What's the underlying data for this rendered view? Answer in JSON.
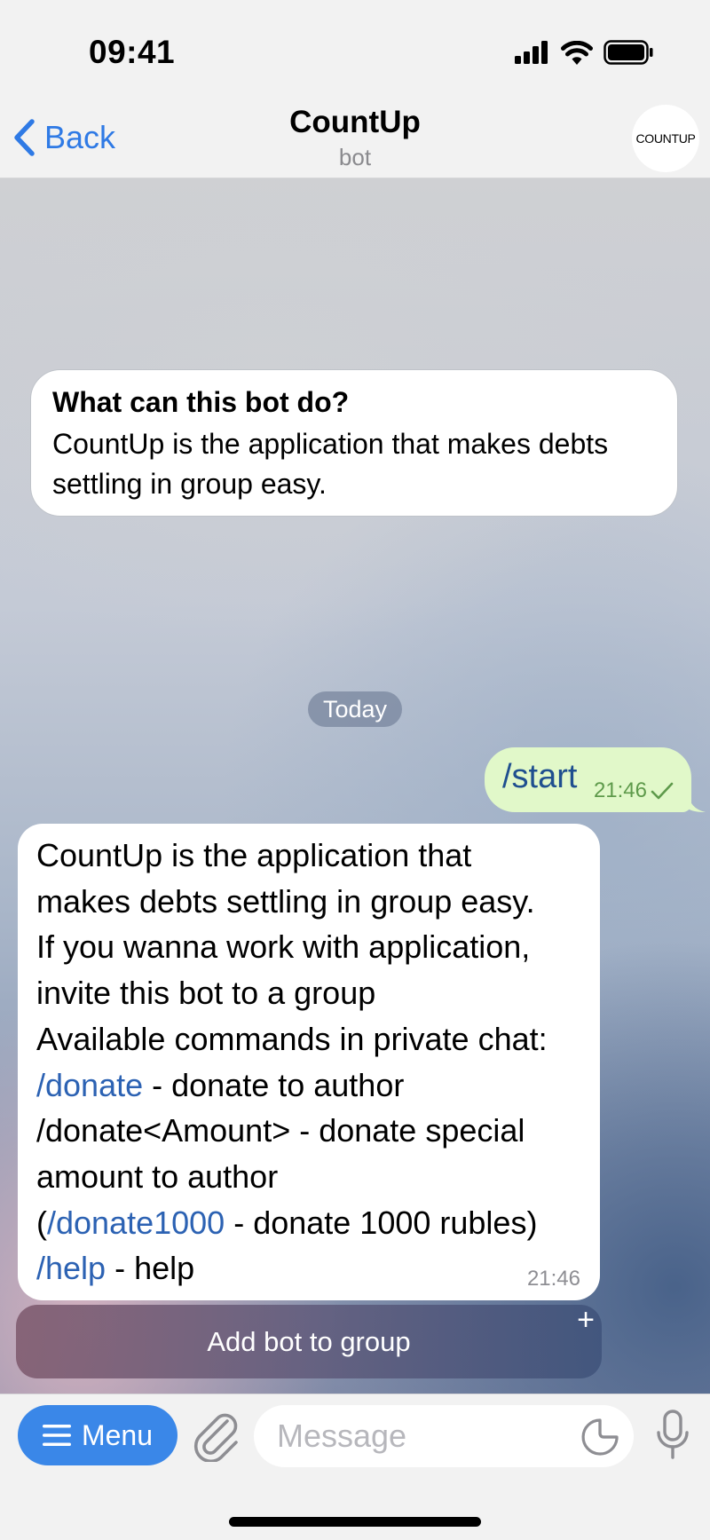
{
  "status_bar": {
    "time": "09:41"
  },
  "nav": {
    "back_label": "Back",
    "title": "CountUp",
    "subtitle": "bot",
    "avatar_text": "COUNTUP"
  },
  "bot_info": {
    "title": "What can this bot do?",
    "description": "CountUp is the application that makes debts settling in group easy."
  },
  "date_separator": "Today",
  "outgoing_message": {
    "text": "/start",
    "time": "21:46"
  },
  "incoming_message": {
    "line1": "CountUp is the application that",
    "line2": "makes debts settling in group easy.",
    "line3": "If you wanna work with application,",
    "line4": "invite this bot to a group",
    "line5": "Available commands in private chat:",
    "donate_cmd": "/donate",
    "donate_desc": " - donate to author",
    "donate_amount": "/donate<Amount> - donate special",
    "donate_amount_cont": "amount to author",
    "paren_open": "(",
    "donate1000_cmd": "/donate1000",
    "donate1000_desc": " - donate 1000 rubles)",
    "help_cmd": "/help",
    "help_desc": " - help",
    "time": "21:46"
  },
  "inline_keyboard": {
    "button_label": "Add bot to group",
    "plus": "+"
  },
  "input_bar": {
    "menu_label": "Menu",
    "message_placeholder": "Message"
  },
  "colors": {
    "accent": "#2f7ae5",
    "menu_button": "#3a87e8",
    "outgoing_bubble": "#e1f8c9",
    "command_link": "#2c62b3"
  },
  "icons": {
    "back": "chevron-left-icon",
    "signal": "signal-icon",
    "wifi": "wifi-icon",
    "battery": "battery-icon",
    "menu": "hamburger-icon",
    "attach": "paperclip-icon",
    "sticker": "sticker-icon",
    "mic": "microphone-icon",
    "read": "checkmark-icon"
  }
}
